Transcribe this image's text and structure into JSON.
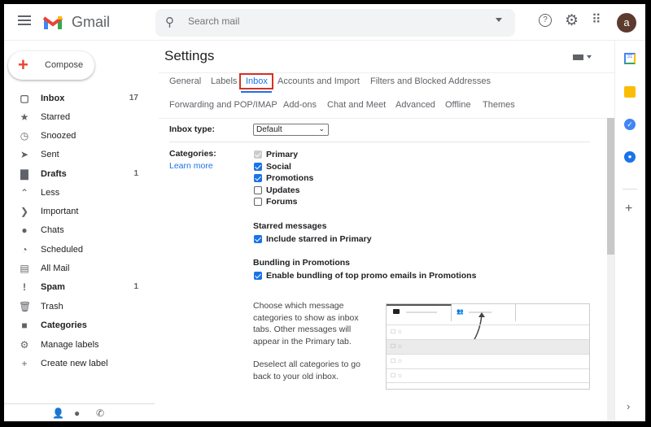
{
  "header": {
    "app_name": "Gmail",
    "search_placeholder": "Search mail",
    "avatar_letter": "a",
    "icons": [
      "menu-icon",
      "search-icon",
      "help-icon",
      "gear-icon",
      "apps-icon"
    ]
  },
  "sidebar": {
    "compose": "Compose",
    "items": [
      {
        "label": "Inbox",
        "count": "17",
        "bold": true,
        "icon": "inbox-icon",
        "glyph": "▢"
      },
      {
        "label": "Starred",
        "count": "",
        "icon": "star-icon",
        "glyph": "★"
      },
      {
        "label": "Snoozed",
        "count": "",
        "icon": "clock-icon",
        "glyph": "◷"
      },
      {
        "label": "Sent",
        "count": "",
        "icon": "send-icon",
        "glyph": "➤"
      },
      {
        "label": "Drafts",
        "count": "1",
        "bold": true,
        "icon": "draft-icon",
        "glyph": "▇"
      },
      {
        "label": "Less",
        "count": "",
        "icon": "chevron-up-icon",
        "glyph": "⌃"
      },
      {
        "label": "Important",
        "count": "",
        "icon": "important-icon",
        "glyph": "❯"
      },
      {
        "label": "Chats",
        "count": "",
        "icon": "chat-icon",
        "glyph": "●"
      },
      {
        "label": "Scheduled",
        "count": "",
        "icon": "scheduled-icon",
        "glyph": "◔"
      },
      {
        "label": "All Mail",
        "count": "",
        "icon": "all-mail-icon",
        "glyph": "▤"
      },
      {
        "label": "Spam",
        "count": "1",
        "bold": true,
        "icon": "spam-icon",
        "glyph": "!"
      },
      {
        "label": "Trash",
        "count": "",
        "icon": "trash-icon",
        "glyph": "🗑"
      },
      {
        "label": "Categories",
        "count": "",
        "bold": true,
        "icon": "label-icon",
        "glyph": "■"
      },
      {
        "label": "Manage labels",
        "count": "",
        "icon": "gear-icon",
        "glyph": "⚙"
      },
      {
        "label": "Create new label",
        "count": "",
        "icon": "plus-icon",
        "glyph": "+"
      }
    ]
  },
  "settings": {
    "title": "Settings",
    "tabs_row1": [
      "General",
      "Labels",
      "Inbox",
      "Accounts and Import",
      "Filters and Blocked Addresses"
    ],
    "tabs_row2": [
      "Forwarding and POP/IMAP",
      "Add-ons",
      "Chat and Meet",
      "Advanced",
      "Offline",
      "Themes"
    ],
    "active_tab": "Inbox",
    "inbox_type_label": "Inbox type:",
    "inbox_type_value": "Default",
    "categories_label": "Categories:",
    "learn_more": "Learn more",
    "categories": [
      {
        "label": "Primary",
        "checked": true,
        "disabled": true
      },
      {
        "label": "Social",
        "checked": true
      },
      {
        "label": "Promotions",
        "checked": true
      },
      {
        "label": "Updates",
        "checked": false
      },
      {
        "label": "Forums",
        "checked": false
      }
    ],
    "starred_heading": "Starred messages",
    "starred_option": "Include starred in Primary",
    "bundling_heading": "Bundling in Promotions",
    "bundling_option": "Enable bundling of top promo emails in Promotions",
    "desc1": "Choose which message categories to show as inbox tabs. Other messages will appear in the Primary tab.",
    "desc2": "Deselect all categories to go back to your old inbox."
  },
  "colors": {
    "accent": "#1a73e8",
    "highlight": "#d93025"
  }
}
